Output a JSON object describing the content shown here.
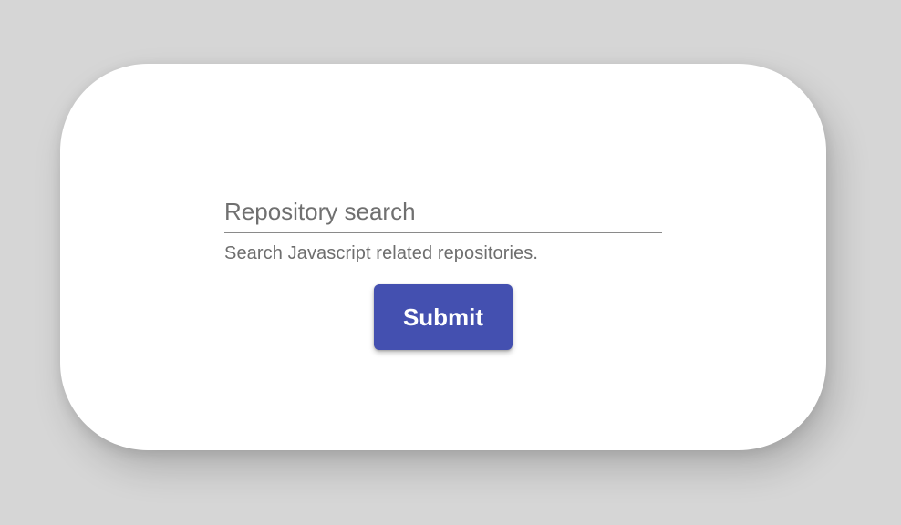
{
  "search": {
    "placeholder": "Repository search",
    "value": "",
    "helper_text": "Search Javascript related repositories."
  },
  "actions": {
    "submit_label": "Submit"
  },
  "colors": {
    "background": "#d6d6d6",
    "card": "#ffffff",
    "button": "#4450b0",
    "underline": "#8a8a8a",
    "helper_text": "#6e6e6e"
  }
}
